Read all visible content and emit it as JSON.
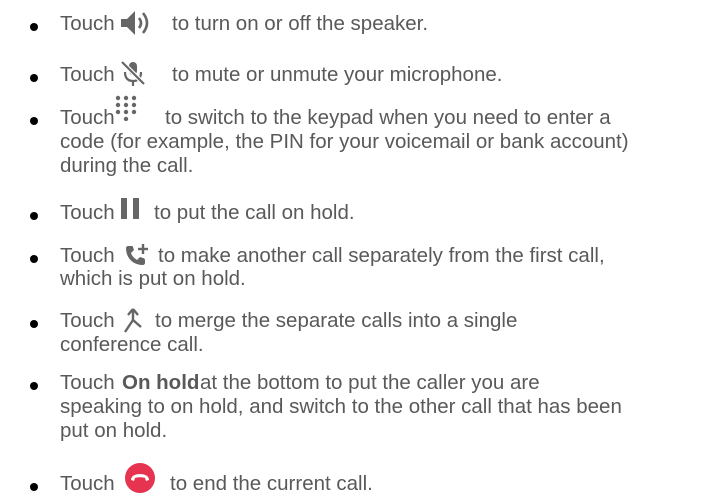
{
  "items": [
    {
      "touch": "Touch",
      "rest": "to turn on or off the speaker.",
      "icon": "speaker-icon"
    },
    {
      "touch": "Touch",
      "rest": "to mute or unmute your microphone.",
      "icon": "mic-off-icon"
    },
    {
      "touch": "Touch",
      "rest": "to switch to the keypad when you need to enter a",
      "line2": "code (for example, the PIN for your voicemail or bank account)",
      "line3": "during the call.",
      "icon": "dialpad-icon"
    },
    {
      "touch": "Touch",
      "rest": "to put the call on hold.",
      "icon": "pause-icon"
    },
    {
      "touch": "Touch",
      "rest": "to make another call separately from the first call,",
      "line2": "which is put on hold.",
      "icon": "add-call-icon"
    },
    {
      "touch": "Touch",
      "rest": "to merge the separate calls into a single",
      "line2": "conference call.",
      "icon": "merge-calls-icon"
    },
    {
      "touch": "Touch",
      "bold": "On hold",
      "rest": "at the bottom to put the caller you are",
      "line2": "speaking to on hold, and switch to the other call that has been",
      "line3": "put on hold.",
      "icon": ""
    },
    {
      "touch": "Touch",
      "rest": "to end the current call.",
      "icon": "end-call-icon"
    }
  ],
  "colors": {
    "text": "#595959",
    "end_call": "#e53350",
    "icon": "#666666"
  }
}
